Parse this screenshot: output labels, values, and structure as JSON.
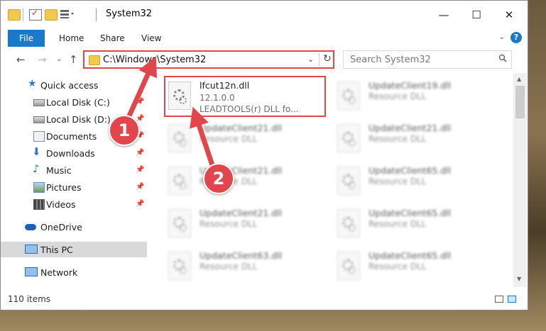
{
  "window": {
    "title": "System32",
    "controls": {
      "minimize": "—",
      "maximize": "☐",
      "close": "✕"
    }
  },
  "ribbon": {
    "tabs": [
      {
        "label": "File"
      },
      {
        "label": "Home"
      },
      {
        "label": "Share"
      },
      {
        "label": "View"
      }
    ],
    "help": "?"
  },
  "navigation": {
    "address": "C:\\Windows\\System32",
    "search_placeholder": "Search System32"
  },
  "sidebar": {
    "items": [
      {
        "label": "Quick access",
        "icon": "star-icon",
        "pinned": false
      },
      {
        "label": "Local Disk (C:)",
        "icon": "drive-icon",
        "pinned": true
      },
      {
        "label": "Local Disk (D:)",
        "icon": "drive-icon",
        "pinned": true
      },
      {
        "label": "Documents",
        "icon": "documents-icon",
        "pinned": true
      },
      {
        "label": "Downloads",
        "icon": "download-icon",
        "pinned": true
      },
      {
        "label": "Music",
        "icon": "music-icon",
        "pinned": true
      },
      {
        "label": "Pictures",
        "icon": "pictures-icon",
        "pinned": true
      },
      {
        "label": "Videos",
        "icon": "videos-icon",
        "pinned": true
      },
      {
        "label": "OneDrive",
        "icon": "cloud-icon",
        "pinned": false
      },
      {
        "label": "This PC",
        "icon": "computer-icon",
        "pinned": false,
        "selected": true
      },
      {
        "label": "Network",
        "icon": "network-icon",
        "pinned": false
      }
    ]
  },
  "files": [
    {
      "name": "lfcut12n.dll",
      "line2": "12.1.0.0",
      "line3": "LEADTOOLS(r) DLL fo...",
      "highlighted": true
    },
    {
      "name": "UpdateClient19.dll",
      "line2": "Resource DLL"
    },
    {
      "name": "UpdateClient21.dll",
      "line2": "Resource DLL"
    },
    {
      "name": "UpdateClient21.dll",
      "line2": "Resource DLL"
    },
    {
      "name": "UpdateClient21.dll",
      "line2": "Resource DLL"
    },
    {
      "name": "UpdateClient65.dll",
      "line2": "Resource DLL"
    },
    {
      "name": "UpdateClient21.dll",
      "line2": "Resource DLL"
    },
    {
      "name": "UpdateClient65.dll",
      "line2": "Resource DLL"
    },
    {
      "name": "UpdateClient63.dll",
      "line2": "Resource DLL"
    },
    {
      "name": "UpdateClient65.dll",
      "line2": "Resource DLL"
    }
  ],
  "status": {
    "item_count": "110 items"
  },
  "callouts": [
    {
      "label": "1"
    },
    {
      "label": "2"
    }
  ],
  "colors": {
    "accent": "#1979ca",
    "highlight": "#e0464c"
  }
}
